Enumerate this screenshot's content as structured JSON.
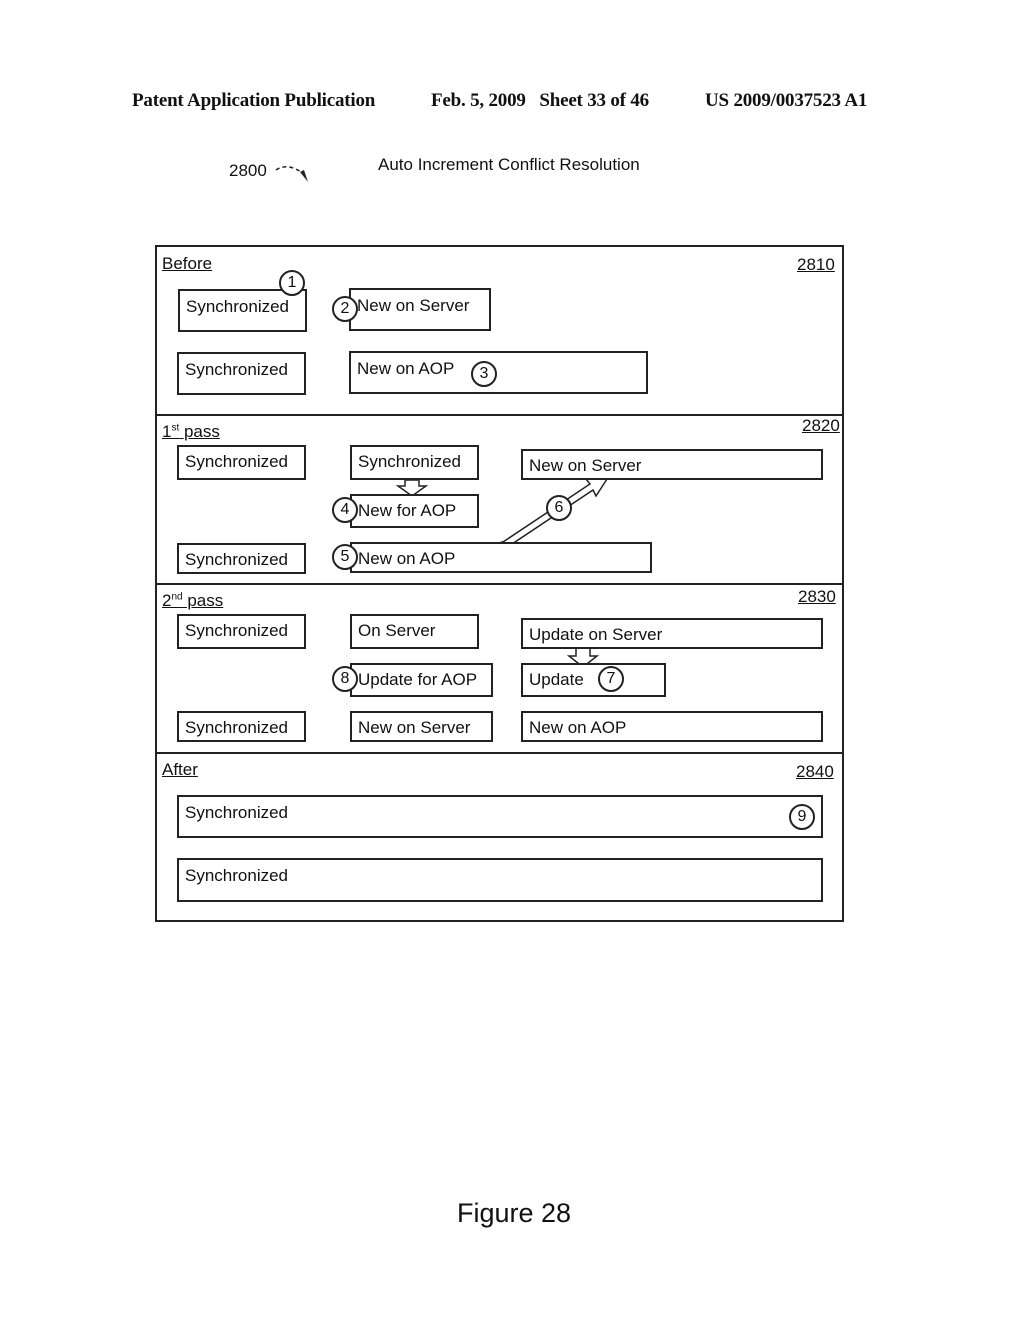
{
  "header": {
    "publication": "Patent Application Publication",
    "date_sheet": "Feb. 5, 2009   Sheet 33 of 46",
    "patent_number": "US 2009/0037523 A1"
  },
  "figure": {
    "ref": "2800",
    "title": "Auto Increment Conflict Resolution",
    "caption": "Figure 28"
  },
  "sections": {
    "before": {
      "label": "Before",
      "ref": "2810",
      "boxes": [
        "Synchronized",
        "New on Server",
        "Synchronized",
        "New on AOP"
      ],
      "markers": [
        "1",
        "2",
        "3"
      ]
    },
    "pass1": {
      "label_num": "1",
      "label_sup": "st",
      "label_text": " pass",
      "ref": "2820",
      "boxes": [
        "Synchronized",
        "Synchronized",
        "New on Server",
        "New for AOP",
        "Synchronized",
        "New on AOP"
      ],
      "markers": [
        "4",
        "5",
        "6"
      ]
    },
    "pass2": {
      "label_num": "2",
      "label_sup": "nd",
      "label_text": " pass",
      "ref": "2830",
      "boxes": [
        "Synchronized",
        "On Server",
        "Update on Server",
        "Update for AOP",
        "Update",
        "Synchronized",
        "New on Server",
        "New on AOP"
      ],
      "markers": [
        "7",
        "8"
      ]
    },
    "after": {
      "label": "After",
      "ref": "2840",
      "boxes": [
        "Synchronized",
        "Synchronized"
      ],
      "markers": [
        "9"
      ]
    }
  }
}
